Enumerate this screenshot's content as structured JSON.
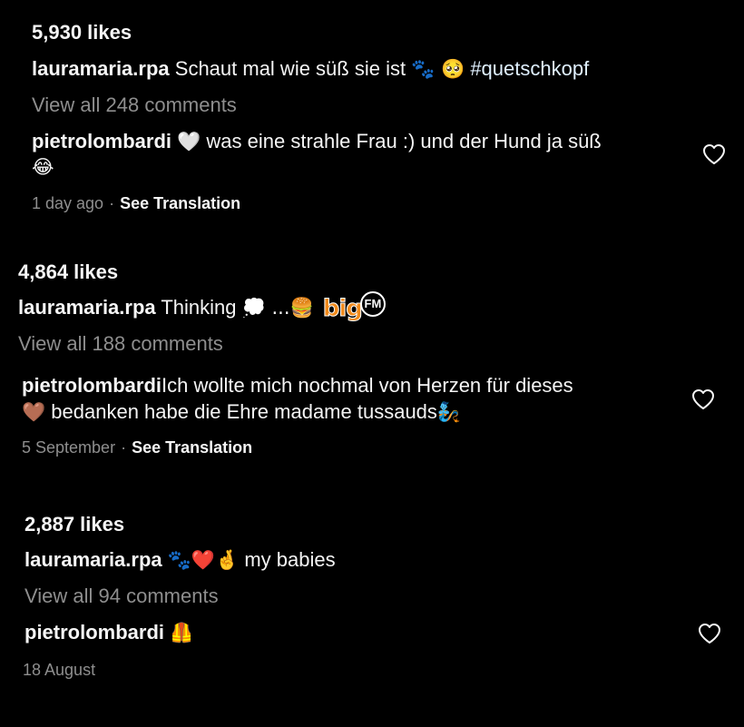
{
  "posts": [
    {
      "likes": "5,930 likes",
      "caption_user": "lauramaria.rpa",
      "caption_text": "Schaut mal wie süß sie ist",
      "caption_emojis": "🐾 🥺",
      "caption_hashtag": "#quetschkopf",
      "view_all": "View all 248 comments",
      "comment_user": "pietrolombardi",
      "comment_emoji_1": "🤍",
      "comment_text_1": "was eine strahle Frau :) und der Hund ja süß",
      "comment_emoji_2": "😂",
      "time": "1 day ago",
      "separator": "·",
      "translate": "See Translation"
    },
    {
      "likes": "4,864 likes",
      "caption_user": "lauramaria.rpa",
      "caption_text": "Thinking",
      "caption_emojis": "💭 ...🍔",
      "logo_big": "big",
      "logo_fm": "FM",
      "view_all": "View all 188 comments",
      "comment_user": "pietrolombardi",
      "comment_text_1": "Ich wollte mich nochmal von Herzen für dieses",
      "comment_emoji_1": "🤎",
      "comment_text_2": "bedanken habe die Ehre madame tussauds",
      "comment_emoji_2": "🧞",
      "time": "5 September",
      "separator": "·",
      "translate": "See Translation"
    },
    {
      "likes": "2,887 likes",
      "caption_user": "lauramaria.rpa",
      "caption_emojis": "🐾❤️🤞",
      "caption_text": "my babies",
      "view_all": "View all 94 comments",
      "comment_user": "pietrolombardi",
      "comment_emoji_1": "🦺",
      "time": "18 August"
    }
  ],
  "colors": {
    "background": "#000000",
    "text": "#f5f5f5",
    "secondary": "#8e8e8e",
    "hashtag": "#e0f1ff",
    "logo": "#f28a1a"
  },
  "icons": {
    "like": "heart-outline-icon"
  }
}
